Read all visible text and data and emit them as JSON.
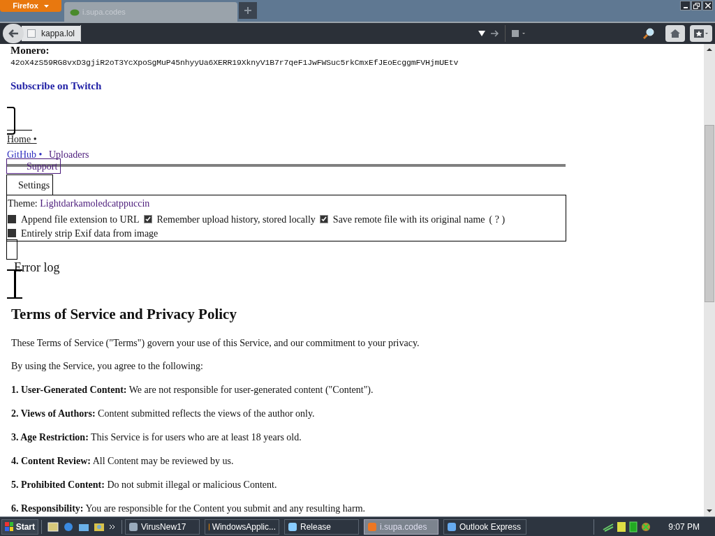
{
  "browser": {
    "menu_button": "Firefox",
    "tab_title": "i.supa.codes",
    "address": "kappa.lol"
  },
  "page": {
    "monero_label": "Monero:",
    "monero_address": "42oX4zS59RG8vxD3gjiR2oT3YcXpoSgMuP45nhyyUa6XERR19XknyV1B7r7qeF1JwFWSuc5rkCmxEfJEoEcggmFVHjmUEtv",
    "subscribe_link": "Subscribe on Twitch",
    "nav": [
      {
        "label": "Home •"
      },
      {
        "label": "GitHub •"
      },
      {
        "label": "Uploaders"
      },
      {
        "label": "Support"
      }
    ],
    "settings_tab": "Settings",
    "theme_label": "Theme:",
    "theme_value": "Lightdarkamoledcatppuccin",
    "options": [
      {
        "label": "Append file extension to URL",
        "checked": false
      },
      {
        "label": "Remember upload history, stored locally",
        "checked": true
      },
      {
        "label": "Save remote file with its original name",
        "checked": true,
        "help": "( ? )"
      },
      {
        "label": "Entirely strip Exif data from image",
        "checked": false
      }
    ],
    "error_log": "Error log",
    "terms": {
      "title": "Terms of Service and Privacy Policy",
      "intro": "These Terms of Service (\"Terms\") govern your use of this Service, and our commitment to your privacy.",
      "agree": "By using the Service, you agree to the following:",
      "items": [
        {
          "heading": "1. User-Generated Content:",
          "text": "We are not responsible for user-generated content (\"Content\")."
        },
        {
          "heading": "2. Views of Authors:",
          "text": "Content submitted reflects the views of the author only."
        },
        {
          "heading": "3. Age Restriction:",
          "text": "This Service is for users who are at least 18 years old."
        },
        {
          "heading": "4. Content Review:",
          "text": "All Content may be reviewed by us."
        },
        {
          "heading": "5. Prohibited Content:",
          "text": "Do not submit illegal or malicious Content."
        },
        {
          "heading": "6. Responsibility:",
          "text": "You are responsible for the Content you submit and any resulting harm."
        }
      ]
    }
  },
  "taskbar": {
    "start": "Start",
    "tasks": [
      {
        "label": "VirusNew17",
        "selected": false
      },
      {
        "label": "WindowsApplic...",
        "selected": false
      },
      {
        "label": "Release",
        "selected": false
      },
      {
        "label": "i.supa.codes",
        "selected": true
      },
      {
        "label": "Outlook Express",
        "selected": false
      }
    ],
    "clock": "9:07 PM"
  }
}
